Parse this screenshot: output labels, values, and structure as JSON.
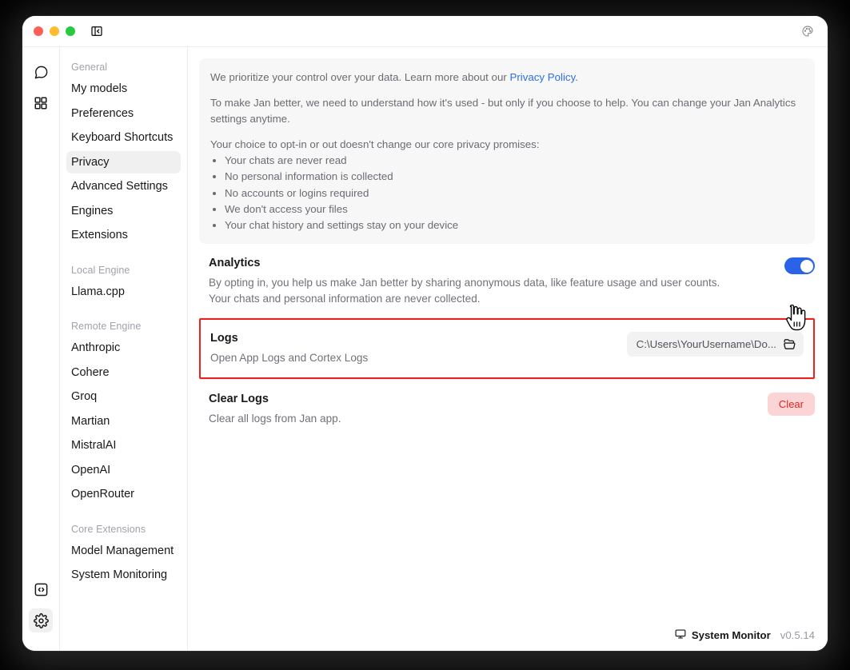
{
  "window": {
    "traffic_lights": [
      "close",
      "minimize",
      "zoom"
    ],
    "panel_toggle_name": "panel-left-collapse-icon",
    "palette_button_name": "palette-icon"
  },
  "rail": {
    "items": [
      {
        "name": "chat-icon",
        "label": "Chat"
      },
      {
        "name": "grid-icon",
        "label": "Hub"
      }
    ],
    "bottom_items": [
      {
        "name": "code-icon",
        "label": "Developer"
      },
      {
        "name": "gear-icon",
        "label": "Settings",
        "active": true
      }
    ]
  },
  "sidebar": {
    "groups": [
      {
        "label": "General",
        "items": [
          {
            "label": "My models",
            "active": false
          },
          {
            "label": "Preferences",
            "active": false
          },
          {
            "label": "Keyboard Shortcuts",
            "active": false
          },
          {
            "label": "Privacy",
            "active": true
          },
          {
            "label": "Advanced Settings",
            "active": false
          },
          {
            "label": "Engines",
            "active": false
          },
          {
            "label": "Extensions",
            "active": false
          }
        ]
      },
      {
        "label": "Local Engine",
        "items": [
          {
            "label": "Llama.cpp",
            "active": false
          }
        ]
      },
      {
        "label": "Remote Engine",
        "items": [
          {
            "label": "Anthropic",
            "active": false
          },
          {
            "label": "Cohere",
            "active": false
          },
          {
            "label": "Groq",
            "active": false
          },
          {
            "label": "Martian",
            "active": false
          },
          {
            "label": "MistralAI",
            "active": false
          },
          {
            "label": "OpenAI",
            "active": false
          },
          {
            "label": "OpenRouter",
            "active": false
          }
        ]
      },
      {
        "label": "Core Extensions",
        "items": [
          {
            "label": "Model Management",
            "active": false
          },
          {
            "label": "System Monitoring",
            "active": false
          }
        ]
      }
    ]
  },
  "main": {
    "info": {
      "para1_before_link": "We prioritize your control over your data. Learn more about our ",
      "link_text": "Privacy Policy",
      "para1_after_link": ".",
      "para2": "To make Jan better, we need to understand how it's used - but only if you choose to help. You can change your Jan Analytics settings anytime.",
      "promises_heading": "Your choice to opt-in or out doesn't change our core privacy promises:",
      "promises": [
        "Your chats are never read",
        "No personal information is collected",
        "No accounts or logins required",
        "We don't access your files",
        "Your chat history and settings stay on your device"
      ]
    },
    "analytics": {
      "title": "Analytics",
      "description": "By opting in, you help us make Jan better by sharing anonymous data, like feature usage and user counts. Your chats and personal information are never collected.",
      "toggle_on": true,
      "toggle_color": "#2a63e8"
    },
    "logs": {
      "title": "Logs",
      "description": "Open App Logs and Cortex Logs",
      "path_value": "C:\\Users\\YourUsername\\Do...",
      "folder_icon_name": "folder-open-icon",
      "highlight_color": "#ef1f1f",
      "highlighted": true
    },
    "clear_logs": {
      "title": "Clear Logs",
      "description": "Clear all logs from Jan app.",
      "button_label": "Clear",
      "button_bg": "#fbd5d5",
      "button_fg": "#e02424"
    }
  },
  "footer": {
    "system_monitor_label": "System Monitor",
    "system_monitor_icon": "monitor-icon",
    "version": "v0.5.14"
  }
}
